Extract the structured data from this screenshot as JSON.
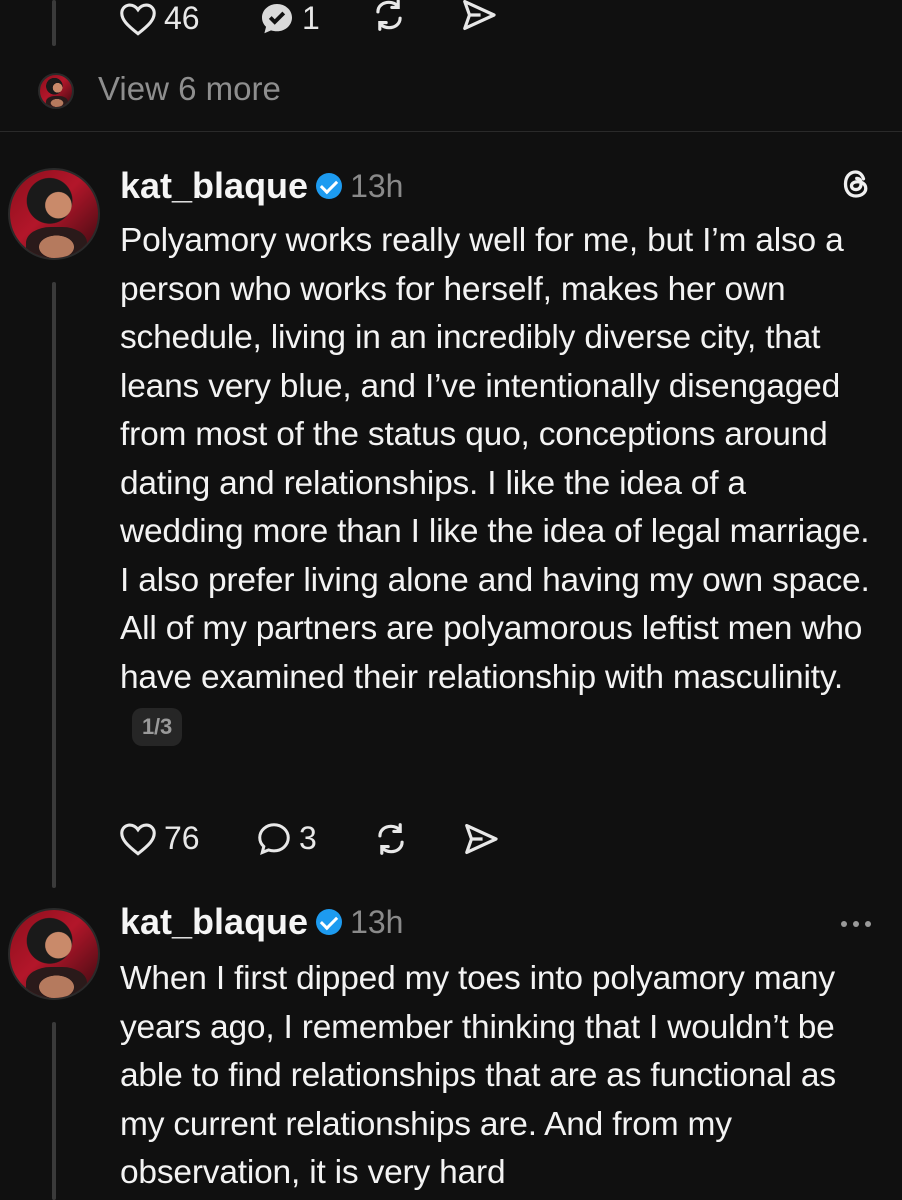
{
  "prev_post": {
    "likes": "46",
    "replies": "1",
    "view_more": "View 6 more"
  },
  "posts": [
    {
      "username": "kat_blaque",
      "time": "13h",
      "text": "Polyamory works really well for me, but I’m also a person who works for herself, makes her own schedule, living in an incredibly diverse city, that leans very blue, and I’ve intentionally disengaged from most of the status quo, conceptions around dating and relationships. I like the idea of a wedding more than I like the idea of legal marriage. I also prefer living alone and having my own space. All of my partners are polyamorous leftist men who have examined their relationship with masculinity.",
      "page": "1/3",
      "likes": "76",
      "replies": "3"
    },
    {
      "username": "kat_blaque",
      "time": "13h",
      "text": "When I first dipped my toes into polyamory many years ago, I remember thinking that I wouldn’t be able to find relationships that are as functional as my current relationships are. And from my observation, it is very hard"
    }
  ],
  "icons": {
    "like": "heart-icon",
    "reply": "comment-icon",
    "repost": "repost-icon",
    "share": "send-icon",
    "threads": "threads-logo-icon",
    "more": "more-icon",
    "verified": "verified-badge-icon"
  },
  "colors": {
    "background": "#101010",
    "text": "#f3f3f3",
    "muted": "#8a8a8a",
    "verified": "#1d9bf0"
  }
}
